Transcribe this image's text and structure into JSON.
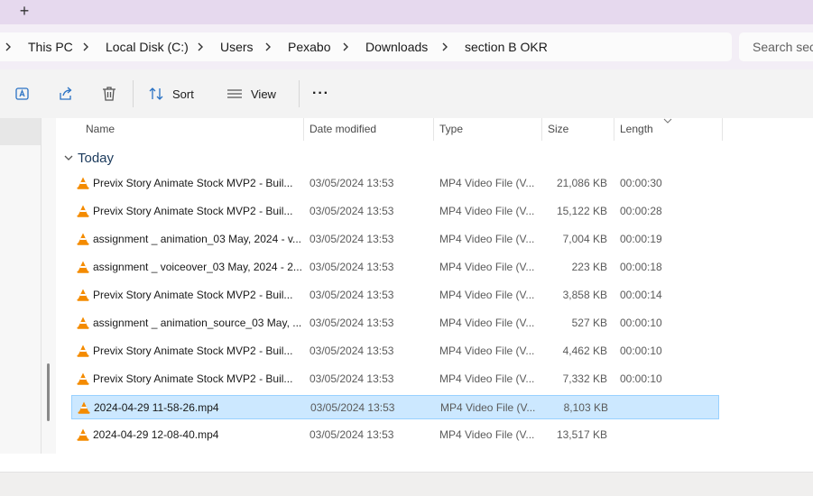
{
  "tabbar": {
    "new_tab": "+"
  },
  "breadcrumb": [
    "This PC",
    "Local Disk (C:)",
    "Users",
    "Pexabo",
    "Downloads",
    "section B OKR"
  ],
  "search": {
    "placeholder": "Search sect"
  },
  "toolbar": {
    "sort_label": "Sort",
    "view_label": "View",
    "more_label": "···"
  },
  "columns": {
    "name": "Name",
    "date": "Date modified",
    "type": "Type",
    "size": "Size",
    "length": "Length"
  },
  "group": {
    "label": "Today"
  },
  "files": [
    {
      "name": "Previx Story  Animate  Stock MVP2 - Buil...",
      "date": "03/05/2024 13:53",
      "type": "MP4 Video File (V...",
      "size": "21,086 KB",
      "length": "00:00:30"
    },
    {
      "name": "Previx Story  Animate  Stock MVP2 - Buil...",
      "date": "03/05/2024 13:53",
      "type": "MP4 Video File (V...",
      "size": "15,122 KB",
      "length": "00:00:28"
    },
    {
      "name": "assignment _ animation_03 May, 2024 - v...",
      "date": "03/05/2024 13:53",
      "type": "MP4 Video File (V...",
      "size": "7,004 KB",
      "length": "00:00:19"
    },
    {
      "name": "assignment _ voiceover_03 May, 2024 - 2...",
      "date": "03/05/2024 13:53",
      "type": "MP4 Video File (V...",
      "size": "223 KB",
      "length": "00:00:18"
    },
    {
      "name": "Previx Story  Animate  Stock MVP2 - Buil...",
      "date": "03/05/2024 13:53",
      "type": "MP4 Video File (V...",
      "size": "3,858 KB",
      "length": "00:00:14"
    },
    {
      "name": "assignment _ animation_source_03 May, ...",
      "date": "03/05/2024 13:53",
      "type": "MP4 Video File (V...",
      "size": "527 KB",
      "length": "00:00:10"
    },
    {
      "name": "Previx Story  Animate  Stock MVP2 - Buil...",
      "date": "03/05/2024 13:53",
      "type": "MP4 Video File (V...",
      "size": "4,462 KB",
      "length": "00:00:10"
    },
    {
      "name": "Previx Story  Animate  Stock MVP2 - Buil...",
      "date": "03/05/2024 13:53",
      "type": "MP4 Video File (V...",
      "size": "7,332 KB",
      "length": "00:00:10"
    },
    {
      "name": "2024-04-29 11-58-26.mp4",
      "date": "03/05/2024 13:53",
      "type": "MP4 Video File (V...",
      "size": "8,103 KB",
      "length": "",
      "selected": true
    },
    {
      "name": "2024-04-29 12-08-40.mp4",
      "date": "03/05/2024 13:53",
      "type": "MP4 Video File (V...",
      "size": "13,517 KB",
      "length": ""
    }
  ],
  "colors": {
    "tabbar": "#e6d9ee",
    "navbar": "#f3eef6",
    "selection": "#cce8ff",
    "selection_border": "#99d1ff",
    "vlc_orange": "#f48b00"
  },
  "icons": {
    "rename": "rename-icon",
    "share": "share-icon",
    "delete": "trash-icon",
    "sort": "sort-icon",
    "view": "view-icon",
    "file": "vlc-cone-icon"
  }
}
